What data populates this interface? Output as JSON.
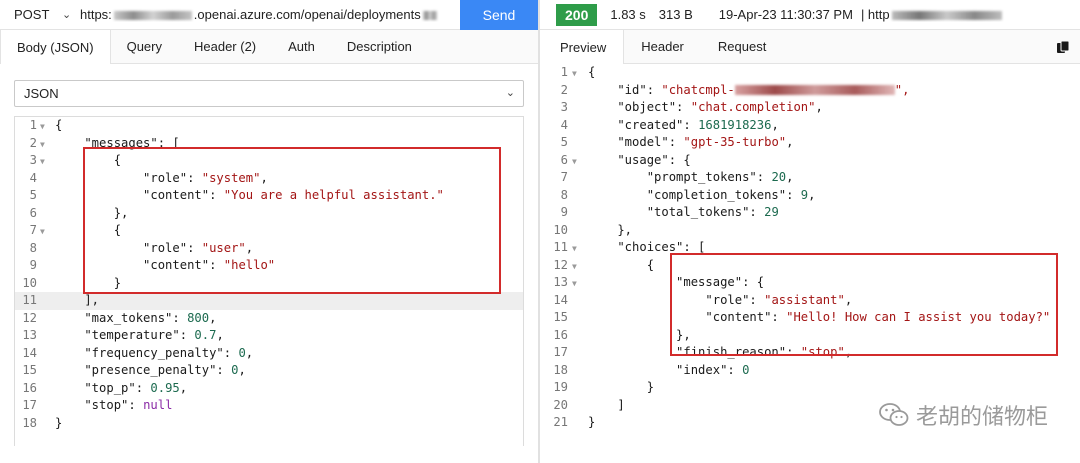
{
  "request": {
    "method": "POST",
    "url_prefix": "https:",
    "url_domain": ".openai.azure.com/openai/deployments",
    "send_label": "Send",
    "tabs": [
      "Body (JSON)",
      "Query",
      "Header (2)",
      "Auth",
      "Description"
    ],
    "body_type": "JSON",
    "body_lines": [
      {
        "n": "1",
        "fold": true,
        "parts": [
          {
            "c": "k",
            "t": "{"
          }
        ]
      },
      {
        "n": "2",
        "fold": true,
        "parts": [
          {
            "c": "k",
            "t": "    \"messages\": ["
          }
        ]
      },
      {
        "n": "3",
        "fold": true,
        "parts": [
          {
            "c": "k",
            "t": "        {"
          }
        ]
      },
      {
        "n": "4",
        "fold": false,
        "parts": [
          {
            "c": "k",
            "t": "            \"role\": "
          },
          {
            "c": "s",
            "t": "\"system\""
          },
          {
            "c": "k",
            "t": ","
          }
        ]
      },
      {
        "n": "5",
        "fold": false,
        "parts": [
          {
            "c": "k",
            "t": "            \"content\": "
          },
          {
            "c": "s",
            "t": "\"You are a helpful assistant.\""
          }
        ]
      },
      {
        "n": "6",
        "fold": false,
        "parts": [
          {
            "c": "k",
            "t": "        },"
          }
        ]
      },
      {
        "n": "7",
        "fold": true,
        "parts": [
          {
            "c": "k",
            "t": "        {"
          }
        ]
      },
      {
        "n": "8",
        "fold": false,
        "parts": [
          {
            "c": "k",
            "t": "            \"role\": "
          },
          {
            "c": "s",
            "t": "\"user\""
          },
          {
            "c": "k",
            "t": ","
          }
        ]
      },
      {
        "n": "9",
        "fold": false,
        "parts": [
          {
            "c": "k",
            "t": "            \"content\": "
          },
          {
            "c": "s",
            "t": "\"hello\""
          }
        ]
      },
      {
        "n": "10",
        "fold": false,
        "parts": [
          {
            "c": "k",
            "t": "        }"
          }
        ]
      },
      {
        "n": "11",
        "fold": false,
        "hl": true,
        "parts": [
          {
            "c": "k",
            "t": "    ],"
          }
        ]
      },
      {
        "n": "12",
        "fold": false,
        "parts": [
          {
            "c": "k",
            "t": "    \"max_tokens\": "
          },
          {
            "c": "n",
            "t": "800"
          },
          {
            "c": "k",
            "t": ","
          }
        ]
      },
      {
        "n": "13",
        "fold": false,
        "parts": [
          {
            "c": "k",
            "t": "    \"temperature\": "
          },
          {
            "c": "n",
            "t": "0.7"
          },
          {
            "c": "k",
            "t": ","
          }
        ]
      },
      {
        "n": "14",
        "fold": false,
        "parts": [
          {
            "c": "k",
            "t": "    \"frequency_penalty\": "
          },
          {
            "c": "n",
            "t": "0"
          },
          {
            "c": "k",
            "t": ","
          }
        ]
      },
      {
        "n": "15",
        "fold": false,
        "parts": [
          {
            "c": "k",
            "t": "    \"presence_penalty\": "
          },
          {
            "c": "n",
            "t": "0"
          },
          {
            "c": "k",
            "t": ","
          }
        ]
      },
      {
        "n": "16",
        "fold": false,
        "parts": [
          {
            "c": "k",
            "t": "    \"top_p\": "
          },
          {
            "c": "n",
            "t": "0.95"
          },
          {
            "c": "k",
            "t": ","
          }
        ]
      },
      {
        "n": "17",
        "fold": false,
        "parts": [
          {
            "c": "k",
            "t": "    \"stop\": "
          },
          {
            "c": "kw",
            "t": "null"
          }
        ]
      },
      {
        "n": "18",
        "fold": false,
        "parts": [
          {
            "c": "k",
            "t": "}"
          }
        ]
      }
    ]
  },
  "response": {
    "status_code": "200",
    "time": "1.83 s",
    "size": "313 B",
    "timestamp": "19-Apr-23 11:30:37 PM",
    "url_prefix": "| http",
    "tabs": [
      "Preview",
      "Header",
      "Request"
    ],
    "body_lines": [
      {
        "n": "1",
        "fold": true,
        "parts": [
          {
            "c": "k",
            "t": "{"
          }
        ]
      },
      {
        "n": "2",
        "fold": false,
        "parts": [
          {
            "c": "k",
            "t": "    \"id\": "
          },
          {
            "c": "s",
            "t": "\"chatcmpl-"
          },
          {
            "c": "blur",
            "t": ""
          },
          {
            "c": "s",
            "t": "\","
          }
        ]
      },
      {
        "n": "3",
        "fold": false,
        "parts": [
          {
            "c": "k",
            "t": "    \"object\": "
          },
          {
            "c": "s",
            "t": "\"chat.completion\""
          },
          {
            "c": "k",
            "t": ","
          }
        ]
      },
      {
        "n": "4",
        "fold": false,
        "parts": [
          {
            "c": "k",
            "t": "    \"created\": "
          },
          {
            "c": "n",
            "t": "1681918236"
          },
          {
            "c": "k",
            "t": ","
          }
        ]
      },
      {
        "n": "5",
        "fold": false,
        "parts": [
          {
            "c": "k",
            "t": "    \"model\": "
          },
          {
            "c": "s",
            "t": "\"gpt-35-turbo\""
          },
          {
            "c": "k",
            "t": ","
          }
        ]
      },
      {
        "n": "6",
        "fold": true,
        "parts": [
          {
            "c": "k",
            "t": "    \"usage\": {"
          }
        ]
      },
      {
        "n": "7",
        "fold": false,
        "parts": [
          {
            "c": "k",
            "t": "        \"prompt_tokens\": "
          },
          {
            "c": "n",
            "t": "20"
          },
          {
            "c": "k",
            "t": ","
          }
        ]
      },
      {
        "n": "8",
        "fold": false,
        "parts": [
          {
            "c": "k",
            "t": "        \"completion_tokens\": "
          },
          {
            "c": "n",
            "t": "9"
          },
          {
            "c": "k",
            "t": ","
          }
        ]
      },
      {
        "n": "9",
        "fold": false,
        "parts": [
          {
            "c": "k",
            "t": "        \"total_tokens\": "
          },
          {
            "c": "n",
            "t": "29"
          }
        ]
      },
      {
        "n": "10",
        "fold": false,
        "parts": [
          {
            "c": "k",
            "t": "    },"
          }
        ]
      },
      {
        "n": "11",
        "fold": true,
        "parts": [
          {
            "c": "k",
            "t": "    \"choices\": ["
          }
        ]
      },
      {
        "n": "12",
        "fold": true,
        "parts": [
          {
            "c": "k",
            "t": "        {"
          }
        ]
      },
      {
        "n": "13",
        "fold": true,
        "parts": [
          {
            "c": "k",
            "t": "            \"message\": {"
          }
        ]
      },
      {
        "n": "14",
        "fold": false,
        "parts": [
          {
            "c": "k",
            "t": "                \"role\": "
          },
          {
            "c": "s",
            "t": "\"assistant\""
          },
          {
            "c": "k",
            "t": ","
          }
        ]
      },
      {
        "n": "15",
        "fold": false,
        "parts": [
          {
            "c": "k",
            "t": "                \"content\": "
          },
          {
            "c": "s",
            "t": "\"Hello! How can I assist you today?\""
          }
        ]
      },
      {
        "n": "16",
        "fold": false,
        "parts": [
          {
            "c": "k",
            "t": "            },"
          }
        ]
      },
      {
        "n": "17",
        "fold": false,
        "parts": [
          {
            "c": "k",
            "t": "            \"finish_reason\": "
          },
          {
            "c": "s",
            "t": "\"stop\""
          },
          {
            "c": "k",
            "t": ","
          }
        ]
      },
      {
        "n": "18",
        "fold": false,
        "parts": [
          {
            "c": "k",
            "t": "            \"index\": "
          },
          {
            "c": "n",
            "t": "0"
          }
        ]
      },
      {
        "n": "19",
        "fold": false,
        "parts": [
          {
            "c": "k",
            "t": "        }"
          }
        ]
      },
      {
        "n": "20",
        "fold": false,
        "parts": [
          {
            "c": "k",
            "t": "    ]"
          }
        ]
      },
      {
        "n": "21",
        "fold": false,
        "parts": [
          {
            "c": "k",
            "t": "}"
          }
        ]
      }
    ]
  },
  "watermark": "老胡的储物柜",
  "colors": {
    "send_button": "#3a88f5",
    "status_ok": "#2e9c49",
    "annotation": "#d22b2b",
    "string": "#a31515",
    "number": "#1c6a4f",
    "keyword": "#8a2aa6"
  },
  "icons": {
    "method_dropdown": "chevron-down-icon",
    "body_type_dropdown": "chevron-down-icon",
    "copy": "copy-icon",
    "fold": "fold-triangle-icon",
    "watermark_logo": "wechat-icon"
  }
}
